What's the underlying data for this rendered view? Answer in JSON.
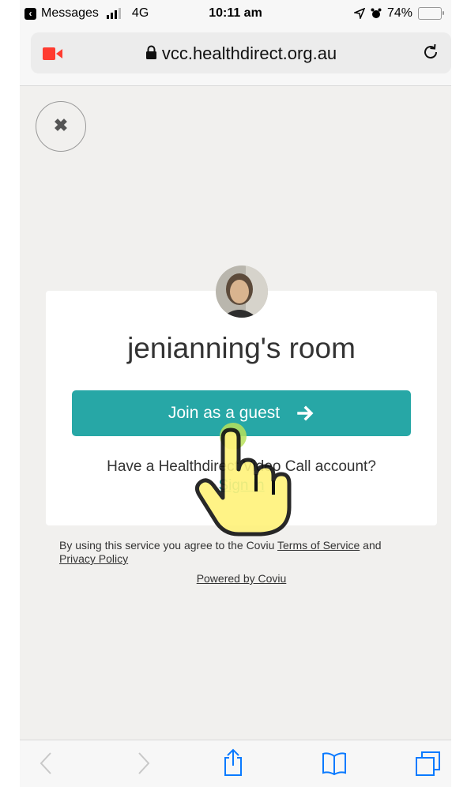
{
  "status_bar": {
    "back_app": "Messages",
    "network": "4G",
    "time": "10:11 am",
    "battery": "74%",
    "battery_level": 0.74
  },
  "browser": {
    "url": "vcc.healthdirect.org.au"
  },
  "room": {
    "title": "jenianning's room",
    "join_button": "Join as a guest",
    "account_prompt": "Have a Healthdirect Video Call account?",
    "sign_in": "Sign in"
  },
  "footer": {
    "terms_prefix": "By using this service you agree to the Coviu",
    "terms_link": "Terms of Service",
    "and": "and",
    "privacy_link": "Privacy Policy",
    "powered_by": "Powered by Coviu"
  },
  "colors": {
    "accent": "#27a7a6",
    "background": "#f1f0ee"
  }
}
